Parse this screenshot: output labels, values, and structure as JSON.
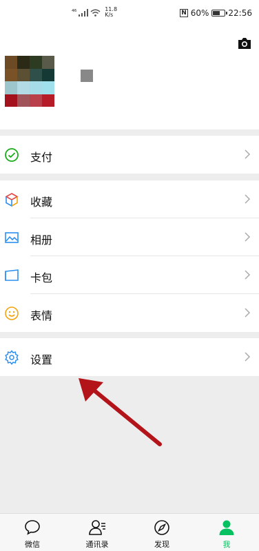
{
  "status_bar": {
    "network_label": "⁴⁶",
    "speed_value": "11.8",
    "speed_unit": "K/s",
    "nfc_label": "N",
    "battery_percent": "60%",
    "battery_level": 0.6,
    "time": "22:56"
  },
  "profile": {
    "avatar_colors": [
      "#6b4a25",
      "#2a2a16",
      "#2d3b22",
      "#5a5a4a",
      "#7a5228",
      "#5b5034",
      "#2f4f4b",
      "#153a36",
      "#9cc5cc",
      "#b3dbe6",
      "#a6dce8",
      "#9fe0ec",
      "#a3121c",
      "#a0545a",
      "#b9404a",
      "#b51c28"
    ]
  },
  "menu": {
    "pay": {
      "label": "支付",
      "icon": "pay-icon"
    },
    "group2": [
      {
        "key": "favorites",
        "label": "收藏",
        "icon": "favorites-cube-icon"
      },
      {
        "key": "album",
        "label": "相册",
        "icon": "album-icon"
      },
      {
        "key": "cards",
        "label": "卡包",
        "icon": "card-wallet-icon"
      },
      {
        "key": "stickers",
        "label": "表情",
        "icon": "smiley-icon"
      }
    ],
    "settings": {
      "label": "设置",
      "icon": "gear-icon"
    }
  },
  "tabbar": {
    "items": [
      {
        "label": "微信",
        "icon": "chat-bubble-icon",
        "active": false
      },
      {
        "label": "通讯录",
        "icon": "contacts-icon",
        "active": false
      },
      {
        "label": "发现",
        "icon": "compass-icon",
        "active": false
      },
      {
        "label": "我",
        "icon": "person-icon",
        "active": true
      }
    ]
  },
  "colors": {
    "accent_green": "#07c160",
    "annotation_arrow": "#b3141a",
    "background": "#ededed"
  }
}
